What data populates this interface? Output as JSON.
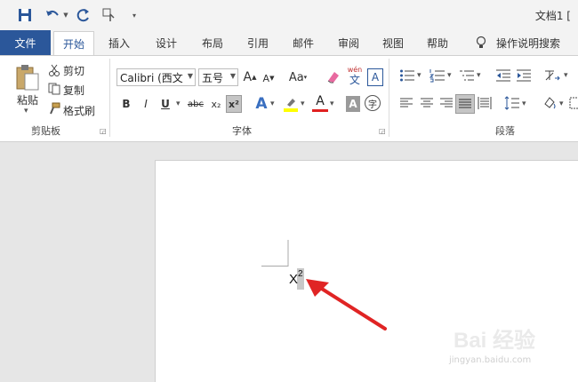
{
  "window": {
    "title": "文档1 ["
  },
  "tabs": {
    "file": "文件",
    "home": "开始",
    "insert": "插入",
    "design": "设计",
    "layout": "布局",
    "references": "引用",
    "mailings": "邮件",
    "review": "审阅",
    "view": "视图",
    "help": "帮助",
    "tell_me": "操作说明搜索"
  },
  "clipboard": {
    "paste": "粘贴",
    "cut": "剪切",
    "copy": "复制",
    "format_painter": "格式刷",
    "group": "剪贴板"
  },
  "font": {
    "name": "Calibri (西文",
    "size": "五号",
    "grow": "A",
    "shrink": "A",
    "change_case": "Aa",
    "phonetic_top": "wén",
    "phonetic_bottom": "文",
    "border_char": "A",
    "bold": "B",
    "italic": "I",
    "underline": "U",
    "strike": "abc",
    "subscript": "x₂",
    "superscript": "x²",
    "effects": "A",
    "font_color": "A",
    "shading": "A",
    "enclose": "字",
    "group": "字体"
  },
  "paragraph": {
    "group": "段落"
  },
  "document": {
    "text": "X",
    "superscript": "2"
  },
  "watermark": {
    "brand": "Bai 经验",
    "url": "jingyan.baidu.com"
  },
  "colors": {
    "accent": "#2b579a",
    "highlight": "#ffff00",
    "font_red": "#e02020",
    "arrow": "#e02424"
  }
}
